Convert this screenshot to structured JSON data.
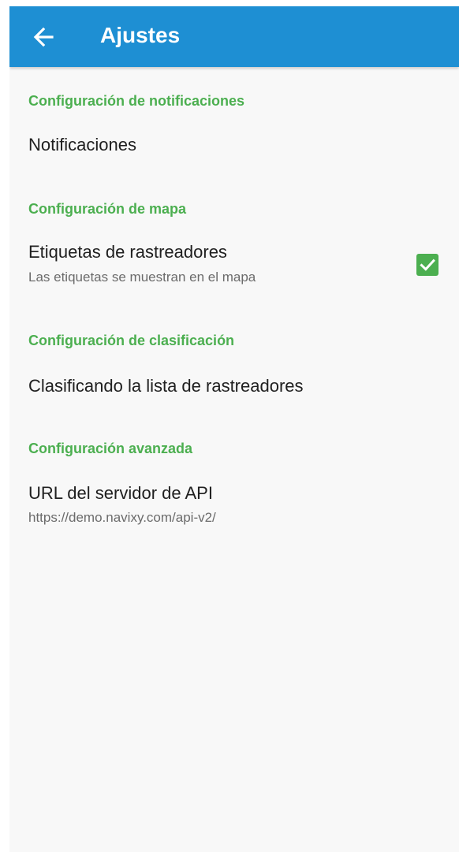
{
  "appbar": {
    "title": "Ajustes",
    "back_icon": "arrow-left-icon",
    "color": "#1e8fd3"
  },
  "sections": [
    {
      "header": "Configuración de notificaciones",
      "items": [
        {
          "title": "Notificaciones"
        }
      ]
    },
    {
      "header": "Configuración de mapa",
      "items": [
        {
          "title": "Etiquetas de rastreadores",
          "summary": "Las etiquetas se muestran en el mapa",
          "checked": true
        }
      ]
    },
    {
      "header": "Configuración de clasificación",
      "items": [
        {
          "title": "Clasificando la lista de rastreadores"
        }
      ]
    },
    {
      "header": "Configuración avanzada",
      "items": [
        {
          "title": "URL del servidor de API",
          "summary": "https://demo.navixy.com/api-v2/"
        }
      ]
    }
  ],
  "colors": {
    "accent": "#4caf50",
    "primary_text": "#202020",
    "secondary_text": "#6b6b6b",
    "background": "#f8f8f8"
  }
}
